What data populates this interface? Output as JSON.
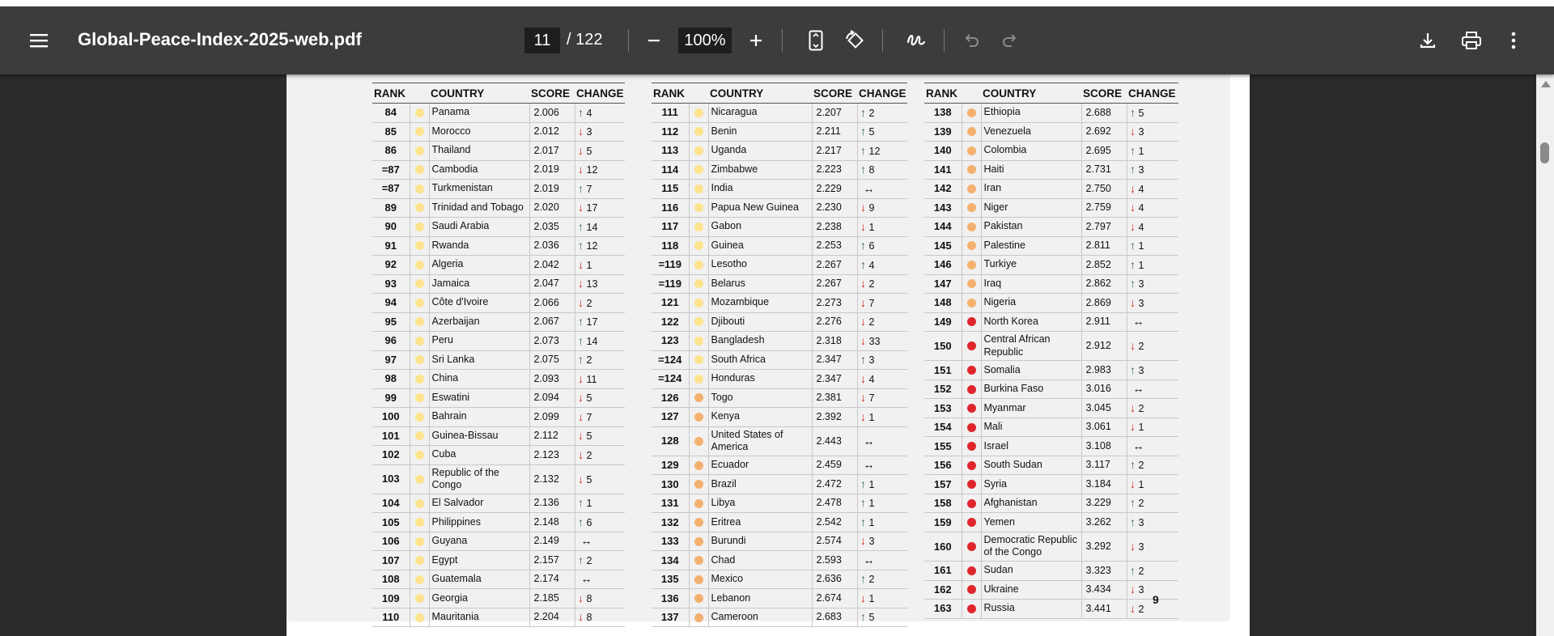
{
  "viewer": {
    "file_name": "Global-Peace-Index-2025-web.pdf",
    "current_page": "11",
    "total_pages": "/ 122",
    "zoom": "100%",
    "menu_icon": "menu-icon",
    "icons": [
      "minus-icon",
      "plus-icon",
      "fit-page-icon",
      "rotate-icon",
      "annotate-icon",
      "undo-icon",
      "redo-icon",
      "download-icon",
      "print-icon",
      "more-options-icon"
    ]
  },
  "page": {
    "number": "9",
    "headers": {
      "rank": "RANK",
      "country": "COUNTRY",
      "score": "SCORE",
      "change": "CHANGE"
    },
    "dot_colors": {
      "y": "#fde38e",
      "o": "#f4b06e",
      "r": "#e0262c"
    },
    "columns": [
      {
        "rows": [
          {
            "rank": "84",
            "dot": "y",
            "country": "Panama",
            "score": "2.006",
            "dir": "up",
            "change": "4"
          },
          {
            "rank": "85",
            "dot": "y",
            "country": "Morocco",
            "score": "2.012",
            "dir": "down",
            "change": "3"
          },
          {
            "rank": "86",
            "dot": "y",
            "country": "Thailand",
            "score": "2.017",
            "dir": "down",
            "change": "5"
          },
          {
            "rank": "=87",
            "dot": "y",
            "country": "Cambodia",
            "score": "2.019",
            "dir": "down",
            "change": "12"
          },
          {
            "rank": "=87",
            "dot": "y",
            "country": "Turkmenistan",
            "score": "2.019",
            "dir": "up",
            "change": "7"
          },
          {
            "rank": "89",
            "dot": "y",
            "country": "Trinidad and Tobago",
            "score": "2.020",
            "dir": "down",
            "change": "17"
          },
          {
            "rank": "90",
            "dot": "y",
            "country": "Saudi Arabia",
            "score": "2.035",
            "dir": "up",
            "change": "14"
          },
          {
            "rank": "91",
            "dot": "y",
            "country": "Rwanda",
            "score": "2.036",
            "dir": "up",
            "change": "12"
          },
          {
            "rank": "92",
            "dot": "y",
            "country": "Algeria",
            "score": "2.042",
            "dir": "down",
            "change": "1"
          },
          {
            "rank": "93",
            "dot": "y",
            "country": "Jamaica",
            "score": "2.047",
            "dir": "down",
            "change": "13"
          },
          {
            "rank": "94",
            "dot": "y",
            "country": "Côte d'Ivoire",
            "score": "2.066",
            "dir": "down",
            "change": "2"
          },
          {
            "rank": "95",
            "dot": "y",
            "country": "Azerbaijan",
            "score": "2.067",
            "dir": "up",
            "change": "17"
          },
          {
            "rank": "96",
            "dot": "y",
            "country": "Peru",
            "score": "2.073",
            "dir": "up",
            "change": "14"
          },
          {
            "rank": "97",
            "dot": "y",
            "country": "Sri Lanka",
            "score": "2.075",
            "dir": "up",
            "change": "2"
          },
          {
            "rank": "98",
            "dot": "y",
            "country": "China",
            "score": "2.093",
            "dir": "down",
            "change": "11"
          },
          {
            "rank": "99",
            "dot": "y",
            "country": "Eswatini",
            "score": "2.094",
            "dir": "down",
            "change": "5"
          },
          {
            "rank": "100",
            "dot": "y",
            "country": "Bahrain",
            "score": "2.099",
            "dir": "down",
            "change": "7"
          },
          {
            "rank": "101",
            "dot": "y",
            "country": "Guinea-Bissau",
            "score": "2.112",
            "dir": "down",
            "change": "5"
          },
          {
            "rank": "102",
            "dot": "y",
            "country": "Cuba",
            "score": "2.123",
            "dir": "down",
            "change": "2"
          },
          {
            "rank": "103",
            "dot": "y",
            "country": "Republic of the Congo",
            "score": "2.132",
            "dir": "down",
            "change": "5"
          },
          {
            "rank": "104",
            "dot": "y",
            "country": "El Salvador",
            "score": "2.136",
            "dir": "up",
            "change": "1"
          },
          {
            "rank": "105",
            "dot": "y",
            "country": "Philippines",
            "score": "2.148",
            "dir": "up",
            "change": "6"
          },
          {
            "rank": "106",
            "dot": "y",
            "country": "Guyana",
            "score": "2.149",
            "dir": "flat",
            "change": ""
          },
          {
            "rank": "107",
            "dot": "y",
            "country": "Egypt",
            "score": "2.157",
            "dir": "up",
            "change": "2"
          },
          {
            "rank": "108",
            "dot": "y",
            "country": "Guatemala",
            "score": "2.174",
            "dir": "flat",
            "change": ""
          },
          {
            "rank": "109",
            "dot": "y",
            "country": "Georgia",
            "score": "2.185",
            "dir": "down",
            "change": "8"
          },
          {
            "rank": "110",
            "dot": "y",
            "country": "Mauritania",
            "score": "2.204",
            "dir": "down",
            "change": "8"
          }
        ]
      },
      {
        "rows": [
          {
            "rank": "111",
            "dot": "y",
            "country": "Nicaragua",
            "score": "2.207",
            "dir": "up",
            "change": "2"
          },
          {
            "rank": "112",
            "dot": "y",
            "country": "Benin",
            "score": "2.211",
            "dir": "up",
            "change": "5"
          },
          {
            "rank": "113",
            "dot": "y",
            "country": "Uganda",
            "score": "2.217",
            "dir": "up",
            "change": "12"
          },
          {
            "rank": "114",
            "dot": "y",
            "country": "Zimbabwe",
            "score": "2.223",
            "dir": "up",
            "change": "8"
          },
          {
            "rank": "115",
            "dot": "y",
            "country": "India",
            "score": "2.229",
            "dir": "flat",
            "change": ""
          },
          {
            "rank": "116",
            "dot": "y",
            "country": "Papua New Guinea",
            "score": "2.230",
            "dir": "down",
            "change": "9"
          },
          {
            "rank": "117",
            "dot": "y",
            "country": "Gabon",
            "score": "2.238",
            "dir": "down",
            "change": "1"
          },
          {
            "rank": "118",
            "dot": "y",
            "country": "Guinea",
            "score": "2.253",
            "dir": "up",
            "change": "6"
          },
          {
            "rank": "=119",
            "dot": "y",
            "country": "Lesotho",
            "score": "2.267",
            "dir": "up",
            "change": "4"
          },
          {
            "rank": "=119",
            "dot": "y",
            "country": "Belarus",
            "score": "2.267",
            "dir": "down",
            "change": "2"
          },
          {
            "rank": "121",
            "dot": "y",
            "country": "Mozambique",
            "score": "2.273",
            "dir": "down",
            "change": "7"
          },
          {
            "rank": "122",
            "dot": "y",
            "country": "Djibouti",
            "score": "2.276",
            "dir": "down",
            "change": "2"
          },
          {
            "rank": "123",
            "dot": "y",
            "country": "Bangladesh",
            "score": "2.318",
            "dir": "down",
            "change": "33"
          },
          {
            "rank": "=124",
            "dot": "y",
            "country": "South Africa",
            "score": "2.347",
            "dir": "up",
            "change": "3"
          },
          {
            "rank": "=124",
            "dot": "y",
            "country": "Honduras",
            "score": "2.347",
            "dir": "down",
            "change": "4"
          },
          {
            "rank": "126",
            "dot": "o",
            "country": "Togo",
            "score": "2.381",
            "dir": "down",
            "change": "7"
          },
          {
            "rank": "127",
            "dot": "o",
            "country": "Kenya",
            "score": "2.392",
            "dir": "down",
            "change": "1"
          },
          {
            "rank": "128",
            "dot": "o",
            "country": "United States of America",
            "score": "2.443",
            "dir": "flat",
            "change": ""
          },
          {
            "rank": "129",
            "dot": "o",
            "country": "Ecuador",
            "score": "2.459",
            "dir": "flat",
            "change": ""
          },
          {
            "rank": "130",
            "dot": "o",
            "country": "Brazil",
            "score": "2.472",
            "dir": "up",
            "change": "1"
          },
          {
            "rank": "131",
            "dot": "o",
            "country": "Libya",
            "score": "2.478",
            "dir": "up",
            "change": "1"
          },
          {
            "rank": "132",
            "dot": "o",
            "country": "Eritrea",
            "score": "2.542",
            "dir": "up",
            "change": "1"
          },
          {
            "rank": "133",
            "dot": "o",
            "country": "Burundi",
            "score": "2.574",
            "dir": "down",
            "change": "3"
          },
          {
            "rank": "134",
            "dot": "o",
            "country": "Chad",
            "score": "2.593",
            "dir": "flat",
            "change": ""
          },
          {
            "rank": "135",
            "dot": "o",
            "country": "Mexico",
            "score": "2.636",
            "dir": "up",
            "change": "2"
          },
          {
            "rank": "136",
            "dot": "o",
            "country": "Lebanon",
            "score": "2.674",
            "dir": "down",
            "change": "1"
          },
          {
            "rank": "137",
            "dot": "o",
            "country": "Cameroon",
            "score": "2.683",
            "dir": "up",
            "change": "5"
          }
        ]
      },
      {
        "rows": [
          {
            "rank": "138",
            "dot": "o",
            "country": "Ethiopia",
            "score": "2.688",
            "dir": "up",
            "change": "5"
          },
          {
            "rank": "139",
            "dot": "o",
            "country": "Venezuela",
            "score": "2.692",
            "dir": "down",
            "change": "3"
          },
          {
            "rank": "140",
            "dot": "o",
            "country": "Colombia",
            "score": "2.695",
            "dir": "up",
            "change": "1"
          },
          {
            "rank": "141",
            "dot": "o",
            "country": "Haiti",
            "score": "2.731",
            "dir": "up",
            "change": "3"
          },
          {
            "rank": "142",
            "dot": "o",
            "country": "Iran",
            "score": "2.750",
            "dir": "down",
            "change": "4"
          },
          {
            "rank": "143",
            "dot": "o",
            "country": "Niger",
            "score": "2.759",
            "dir": "down",
            "change": "4"
          },
          {
            "rank": "144",
            "dot": "o",
            "country": "Pakistan",
            "score": "2.797",
            "dir": "down",
            "change": "4"
          },
          {
            "rank": "145",
            "dot": "o",
            "country": "Palestine",
            "score": "2.811",
            "dir": "up",
            "change": "1"
          },
          {
            "rank": "146",
            "dot": "o",
            "country": "Turkiye",
            "score": "2.852",
            "dir": "up",
            "change": "1"
          },
          {
            "rank": "147",
            "dot": "o",
            "country": "Iraq",
            "score": "2.862",
            "dir": "up",
            "change": "3"
          },
          {
            "rank": "148",
            "dot": "o",
            "country": "Nigeria",
            "score": "2.869",
            "dir": "down",
            "change": "3"
          },
          {
            "rank": "149",
            "dot": "r",
            "country": "North Korea",
            "score": "2.911",
            "dir": "flat",
            "change": ""
          },
          {
            "rank": "150",
            "dot": "r",
            "country": "Central African Republic",
            "score": "2.912",
            "dir": "down",
            "change": "2"
          },
          {
            "rank": "151",
            "dot": "r",
            "country": "Somalia",
            "score": "2.983",
            "dir": "up",
            "change": "3"
          },
          {
            "rank": "152",
            "dot": "r",
            "country": "Burkina Faso",
            "score": "3.016",
            "dir": "flat",
            "change": ""
          },
          {
            "rank": "153",
            "dot": "r",
            "country": "Myanmar",
            "score": "3.045",
            "dir": "down",
            "change": "2"
          },
          {
            "rank": "154",
            "dot": "r",
            "country": "Mali",
            "score": "3.061",
            "dir": "down",
            "change": "1"
          },
          {
            "rank": "155",
            "dot": "r",
            "country": "Israel",
            "score": "3.108",
            "dir": "flat",
            "change": ""
          },
          {
            "rank": "156",
            "dot": "r",
            "country": "South Sudan",
            "score": "3.117",
            "dir": "up",
            "change": "2"
          },
          {
            "rank": "157",
            "dot": "r",
            "country": "Syria",
            "score": "3.184",
            "dir": "down",
            "change": "1"
          },
          {
            "rank": "158",
            "dot": "r",
            "country": "Afghanistan",
            "score": "3.229",
            "dir": "up",
            "change": "2"
          },
          {
            "rank": "159",
            "dot": "r",
            "country": "Yemen",
            "score": "3.262",
            "dir": "up",
            "change": "3"
          },
          {
            "rank": "160",
            "dot": "r",
            "country": "Democratic Republic of the Congo",
            "score": "3.292",
            "dir": "down",
            "change": "3"
          },
          {
            "rank": "161",
            "dot": "r",
            "country": "Sudan",
            "score": "3.323",
            "dir": "up",
            "change": "2"
          },
          {
            "rank": "162",
            "dot": "r",
            "country": "Ukraine",
            "score": "3.434",
            "dir": "down",
            "change": "3"
          },
          {
            "rank": "163",
            "dot": "r",
            "country": "Russia",
            "score": "3.441",
            "dir": "down",
            "change": "2"
          }
        ]
      }
    ]
  }
}
